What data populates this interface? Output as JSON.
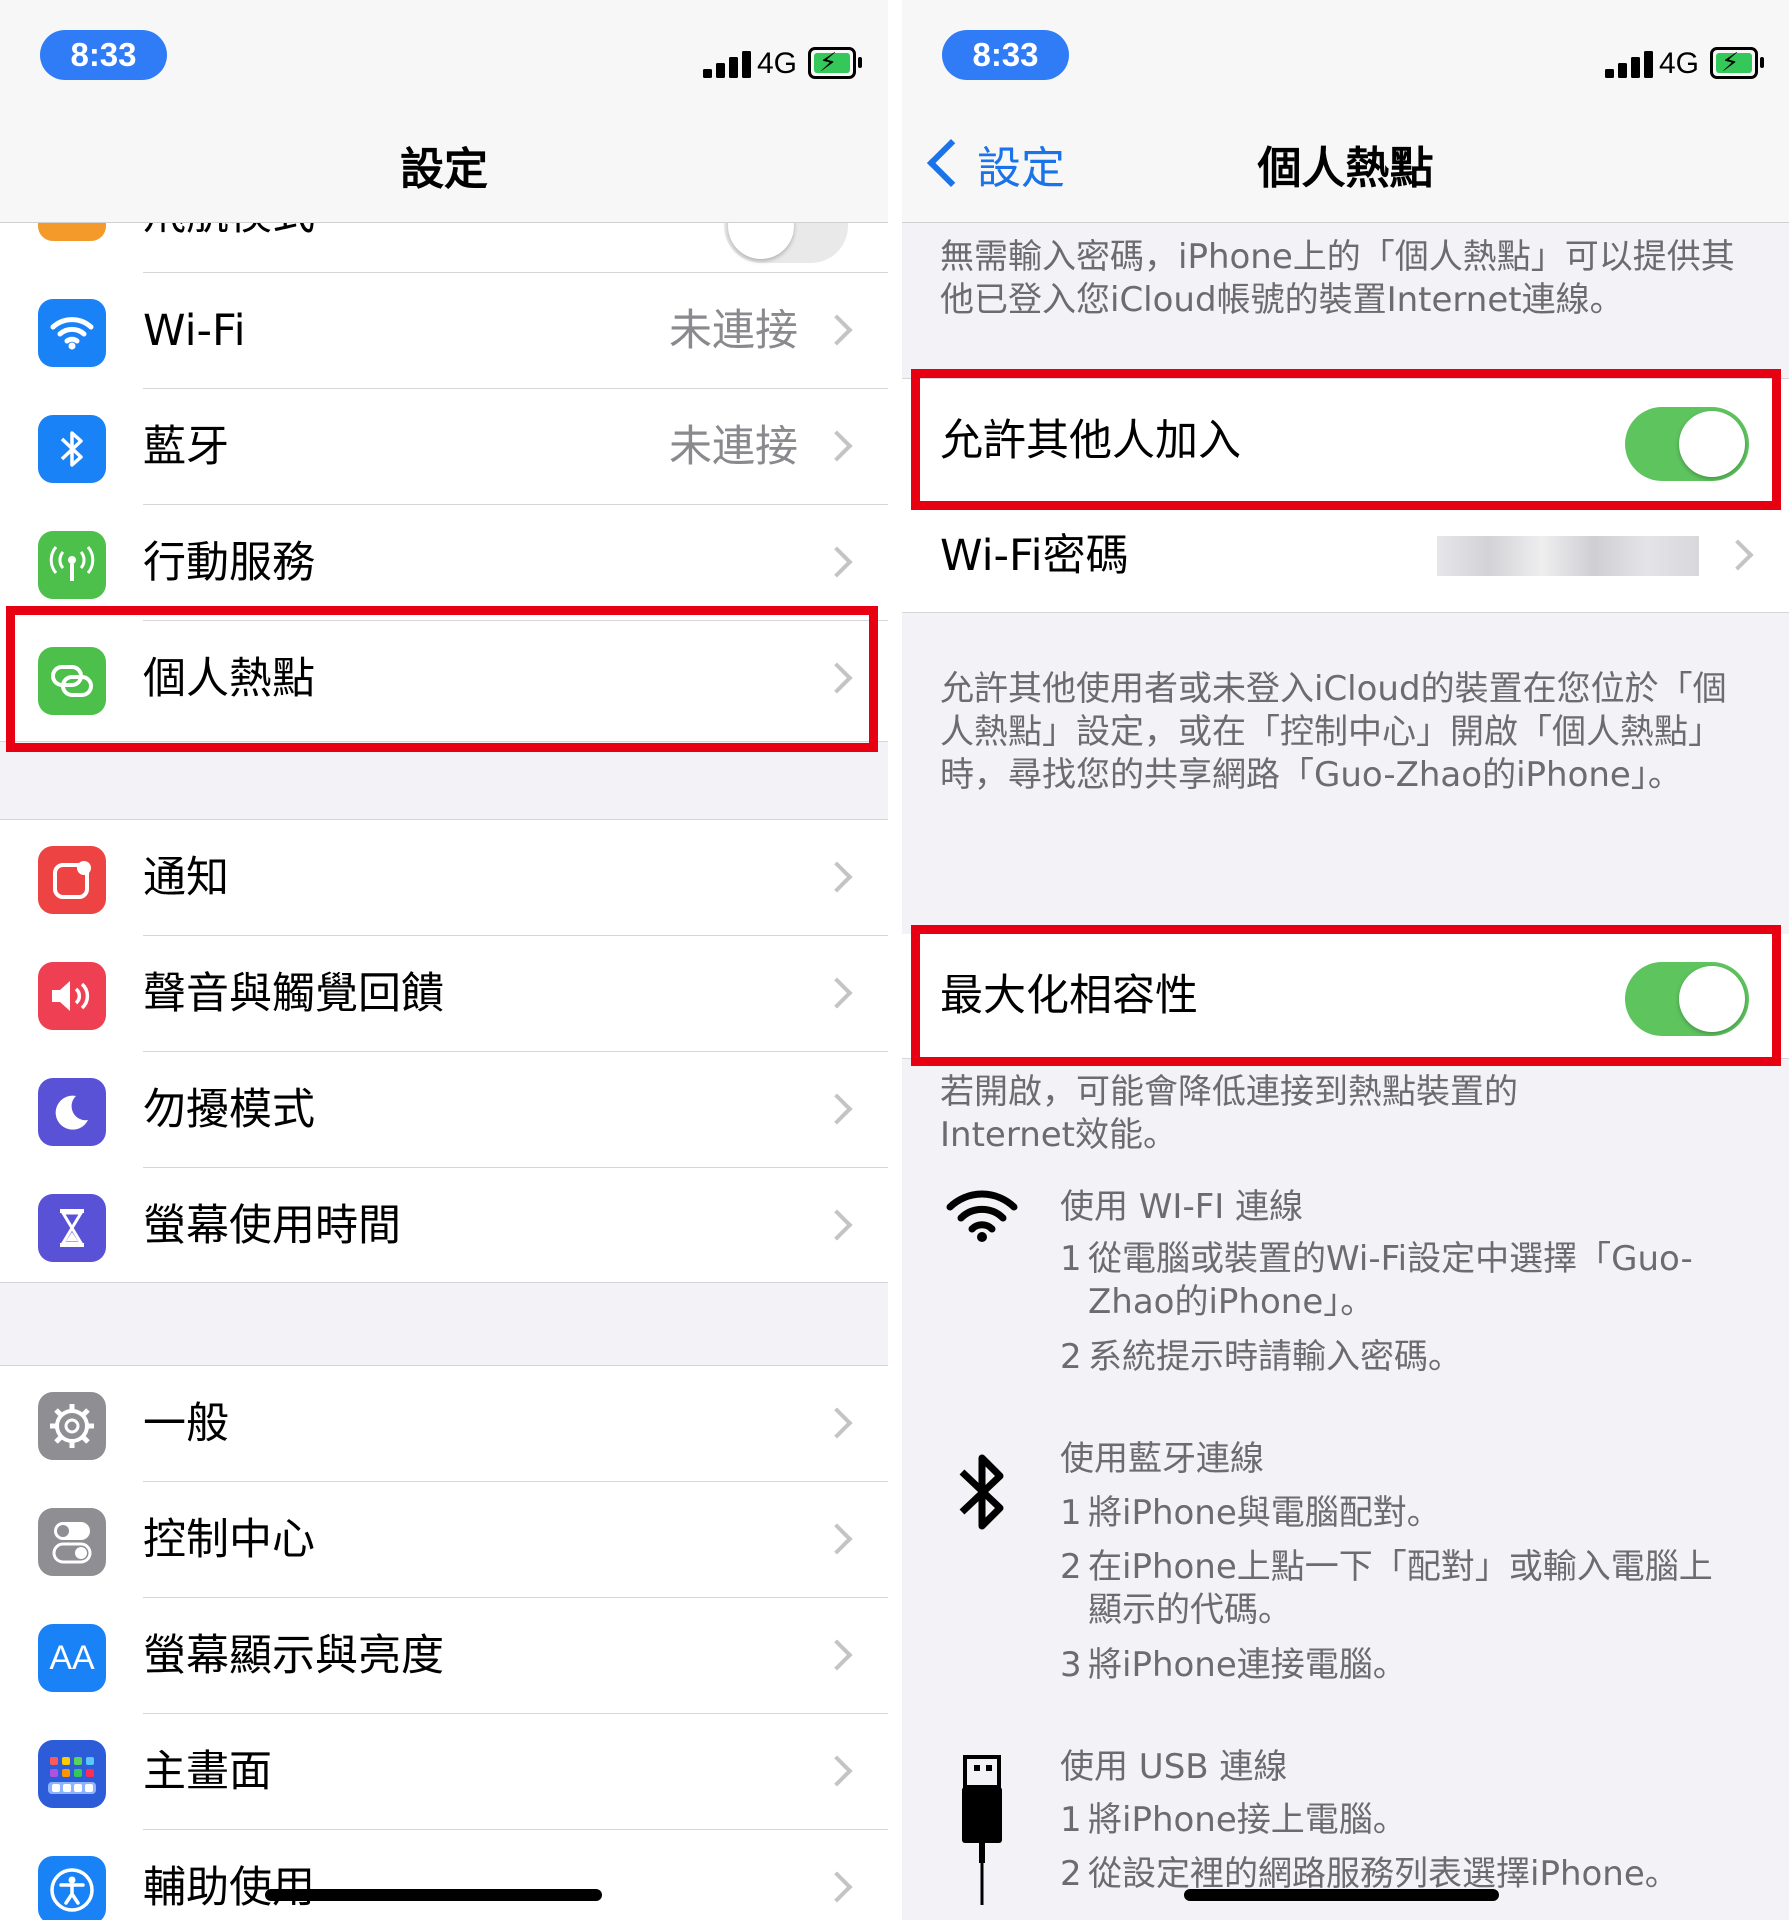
{
  "status_bar": {
    "time": "8:33",
    "network": "4G"
  },
  "left": {
    "nav_title": "設定",
    "partial_row": {
      "label": "飛航模式"
    },
    "group1": [
      {
        "name": "wifi",
        "label": "Wi-Fi",
        "value": "未連接",
        "color": "#1a82f7"
      },
      {
        "name": "bluetooth",
        "label": "藍牙",
        "value": "未連接",
        "color": "#1a82f7"
      },
      {
        "name": "cellular",
        "label": "行動服務",
        "value": "",
        "color": "#4cc04b"
      },
      {
        "name": "hotspot",
        "label": "個人熱點",
        "value": "",
        "color": "#4cc04b"
      }
    ],
    "group2": [
      {
        "name": "notifications",
        "label": "通知",
        "color": "#ee4343"
      },
      {
        "name": "sounds",
        "label": "聲音與觸覺回饋",
        "color": "#ee3f53"
      },
      {
        "name": "dnd",
        "label": "勿擾模式",
        "color": "#5a52d6"
      },
      {
        "name": "screentime",
        "label": "螢幕使用時間",
        "color": "#5a52d6"
      }
    ],
    "group3": [
      {
        "name": "general",
        "label": "一般",
        "color": "#8e8e93"
      },
      {
        "name": "control-center",
        "label": "控制中心",
        "color": "#8e8e93"
      },
      {
        "name": "display",
        "label": "螢幕顯示與亮度",
        "color": "#1a82f7",
        "icon_text": "AA"
      },
      {
        "name": "home-screen",
        "label": "主畫面",
        "color": "#2d5cd8"
      },
      {
        "name": "accessibility",
        "label": "輔助使用",
        "color": "#1a82f7"
      }
    ]
  },
  "right": {
    "back_label": "設定",
    "nav_title": "個人熱點",
    "intro": "無需輸入密碼，iPhone上的「個人熱點」可以提供其他已登入您iCloud帳號的裝置Internet連線。",
    "allow_others": {
      "label": "允許其他人加入",
      "on": true
    },
    "wifi_password": {
      "label": "Wi-Fi密碼"
    },
    "allow_desc": "允許其他使用者或未登入iCloud的裝置在您位於「個人熱點」設定，或在「控制中心」開啟「個人熱點」時，尋找您的共享網路「Guo-Zhao的iPhone」。",
    "max_compat": {
      "label": "最大化相容性",
      "on": true
    },
    "max_desc": "若開啟，可能會降低連接到熱點裝置的Internet效能。",
    "methods": [
      {
        "icon": "wifi-icon",
        "title": "使用 WI-FI 連線",
        "steps": [
          {
            "num": "1",
            "line1": "從電腦或裝置的Wi-Fi設定中選擇「Guo-",
            "line2": "Zhao的iPhone」。"
          },
          {
            "num": "2",
            "line1": "系統提示時請輸入密碼。",
            "line2": ""
          }
        ]
      },
      {
        "icon": "bluetooth-icon",
        "title": "使用藍牙連線",
        "steps": [
          {
            "num": "1",
            "line1": "將iPhone與電腦配對。",
            "line2": ""
          },
          {
            "num": "2",
            "line1": "在iPhone上點一下「配對」或輸入電腦上",
            "line2": "顯示的代碼。"
          },
          {
            "num": "3",
            "line1": "將iPhone連接電腦。",
            "line2": ""
          }
        ]
      },
      {
        "icon": "usb-cable-icon",
        "title": "使用 USB 連線",
        "steps": [
          {
            "num": "1",
            "line1": "將iPhone接上電腦。",
            "line2": ""
          },
          {
            "num": "2",
            "line1": "從設定裡的網路服務列表選擇iPhone。",
            "line2": ""
          }
        ]
      }
    ]
  }
}
